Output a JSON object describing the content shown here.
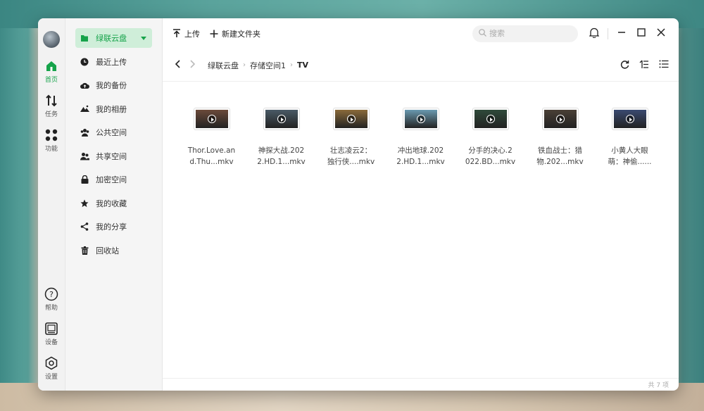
{
  "rail": {
    "items": [
      {
        "label": "首页"
      },
      {
        "label": "任务"
      },
      {
        "label": "功能"
      }
    ],
    "bottom": [
      {
        "label": "帮助"
      },
      {
        "label": "设备"
      },
      {
        "label": "设置"
      }
    ]
  },
  "sidebar": {
    "items": [
      {
        "label": "绿联云盘"
      },
      {
        "label": "最近上传"
      },
      {
        "label": "我的备份"
      },
      {
        "label": "我的相册"
      },
      {
        "label": "公共空间"
      },
      {
        "label": "共享空间"
      },
      {
        "label": "加密空间"
      },
      {
        "label": "我的收藏"
      },
      {
        "label": "我的分享"
      },
      {
        "label": "回收站"
      }
    ]
  },
  "toolbar": {
    "upload_label": "上传",
    "new_folder_label": "新建文件夹",
    "search_placeholder": "搜索"
  },
  "breadcrumb": [
    "绿联云盘",
    "存储空间1",
    "TV"
  ],
  "files": [
    {
      "name": "Thor.Love.and.Thu...mkv",
      "line1": "Thor.Love.an",
      "line2": "d.Thu...mkv",
      "thumb_color": "#6b4a3a"
    },
    {
      "name": "神探大战.2022.HD.1...mkv",
      "line1": "神探大战.202",
      "line2": "2.HD.1...mkv",
      "thumb_color": "#4a5a66"
    },
    {
      "name": "壮志凌云2：独行侠....mkv",
      "line1": "壮志凌云2：",
      "line2": "独行侠....mkv",
      "thumb_color": "#8a6a3a"
    },
    {
      "name": "冲出地球.2022.HD.1...mkv",
      "line1": "冲出地球.202",
      "line2": "2.HD.1...mkv",
      "thumb_color": "#6a9ab0"
    },
    {
      "name": "分手的决心.2022.BD...mkv",
      "line1": "分手的决心.2",
      "line2": "022.BD...mkv",
      "thumb_color": "#2f4a3a"
    },
    {
      "name": "铁血战士：猎物.202...mkv",
      "line1": "铁血战士：猎",
      "line2": "物.202...mkv",
      "thumb_color": "#4a4036"
    },
    {
      "name": "小黄人大眼萌：神偷......",
      "line1": "小黄人大眼",
      "line2": "萌：神偷......",
      "thumb_color": "#3a4a70"
    }
  ],
  "status": {
    "count_text": "共 7 项"
  },
  "colors": {
    "accent": "#16a34a",
    "active_bg": "#cfeed9"
  }
}
